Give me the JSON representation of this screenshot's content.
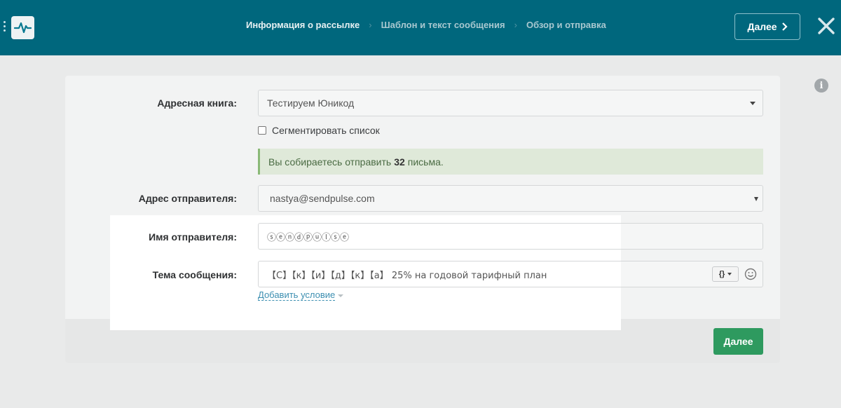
{
  "header": {
    "steps": [
      {
        "label": "Информация о рассылке",
        "active": true
      },
      {
        "label": "Шаблон и текст сообщения",
        "active": false
      },
      {
        "label": "Обзор и отправка",
        "active": false
      }
    ],
    "next_label": "Далее"
  },
  "form": {
    "address_book": {
      "label": "Адресная книга:",
      "value": "Тестируем Юникод"
    },
    "segment_label": "Сегментировать список",
    "alert": {
      "prefix": "Вы собираетесь отправить",
      "count": "32",
      "suffix": "письма."
    },
    "sender_address": {
      "label": "Адрес отправителя:",
      "value": "nastya@sendpulse.com"
    },
    "sender_name": {
      "label": "Имя отправителя:",
      "value": "ⓢⓔⓝⓓⓟⓤⓛⓢⓔ"
    },
    "subject": {
      "label": "Тема сообщения:",
      "value": "【С】【к】【и】【д】【к】【а】 25% на годовой тарифный план"
    },
    "add_condition_label": "Добавить условие"
  },
  "footer": {
    "next_label": "Далее"
  },
  "icons": [
    "menu-dots-icon",
    "pulse-logo-icon",
    "chevron-right-icon",
    "close-icon",
    "info-icon",
    "caret-down-icon",
    "variables-icon",
    "emoji-icon"
  ],
  "colors": {
    "header_bg": "#00677d",
    "primary_button": "#2e9a5f",
    "alert_bg": "#dfe9d9",
    "link": "#3d8fb1"
  }
}
